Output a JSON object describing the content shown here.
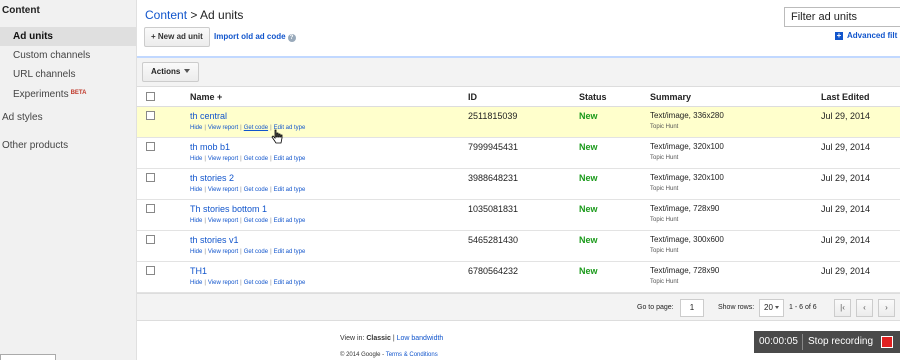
{
  "sidebar": {
    "header": "Content",
    "items": [
      {
        "label": "Ad units"
      },
      {
        "label": "Custom channels"
      },
      {
        "label": "URL channels"
      },
      {
        "label": "Experiments",
        "badge": "BETA"
      }
    ],
    "sections": [
      "Ad styles",
      "Other products"
    ]
  },
  "breadcrumb": {
    "parent": "Content",
    "separator": " > ",
    "current": "Ad units"
  },
  "filter": {
    "value": "Filter ad units"
  },
  "advanced": {
    "label": "Advanced filt"
  },
  "toolbar": {
    "new_label": "+ New ad unit",
    "import_label": "Import old ad code",
    "help_icon": "?"
  },
  "actions": {
    "label": "Actions"
  },
  "table": {
    "headers": {
      "name": "Name +",
      "id": "ID",
      "status": "Status",
      "summary": "Summary",
      "edited": "Last Edited"
    },
    "link_labels": [
      "Hide",
      "View report",
      "Get code",
      "Edit ad type"
    ],
    "rows": [
      {
        "name": "th central",
        "id": "2511815039",
        "status": "New",
        "summary": "Text/image, 336x280",
        "sub": "Topic Hunt",
        "date": "Jul 29, 2014"
      },
      {
        "name": "th mob b1",
        "id": "7999945431",
        "status": "New",
        "summary": "Text/image, 320x100",
        "sub": "Topic Hunt",
        "date": "Jul 29, 2014"
      },
      {
        "name": "th stories 2",
        "id": "3988648231",
        "status": "New",
        "summary": "Text/image, 320x100",
        "sub": "Topic Hunt",
        "date": "Jul 29, 2014"
      },
      {
        "name": "Th stories bottom 1",
        "id": "1035081831",
        "status": "New",
        "summary": "Text/image, 728x90",
        "sub": "Topic Hunt",
        "date": "Jul 29, 2014"
      },
      {
        "name": "th stories v1",
        "id": "5465281430",
        "status": "New",
        "summary": "Text/image, 300x600",
        "sub": "Topic Hunt",
        "date": "Jul 29, 2014"
      },
      {
        "name": "TH1",
        "id": "6780564232",
        "status": "New",
        "summary": "Text/image, 728x90",
        "sub": "Topic Hunt",
        "date": "Jul 29, 2014"
      }
    ]
  },
  "pager": {
    "goto_label": "Go to page:",
    "page": "1",
    "show_label": "Show rows:",
    "rows": "20",
    "range": "1 - 6 of 6",
    "first": "|‹",
    "prev": "‹",
    "next": "›"
  },
  "footer": {
    "view_label": "View in:",
    "view_classic": "Classic",
    "view_sep": " | ",
    "view_alt": "Low bandwidth",
    "copyright": "© 2014 Google - ",
    "terms": "Terms & Conditions"
  },
  "recording": {
    "time": "00:00:05",
    "label": "Stop recording"
  },
  "colors": {
    "link": "#1155cc",
    "status_new": "#1a9a1a",
    "highlight_row": "#ffffcc",
    "record_stop": "#e02020"
  }
}
